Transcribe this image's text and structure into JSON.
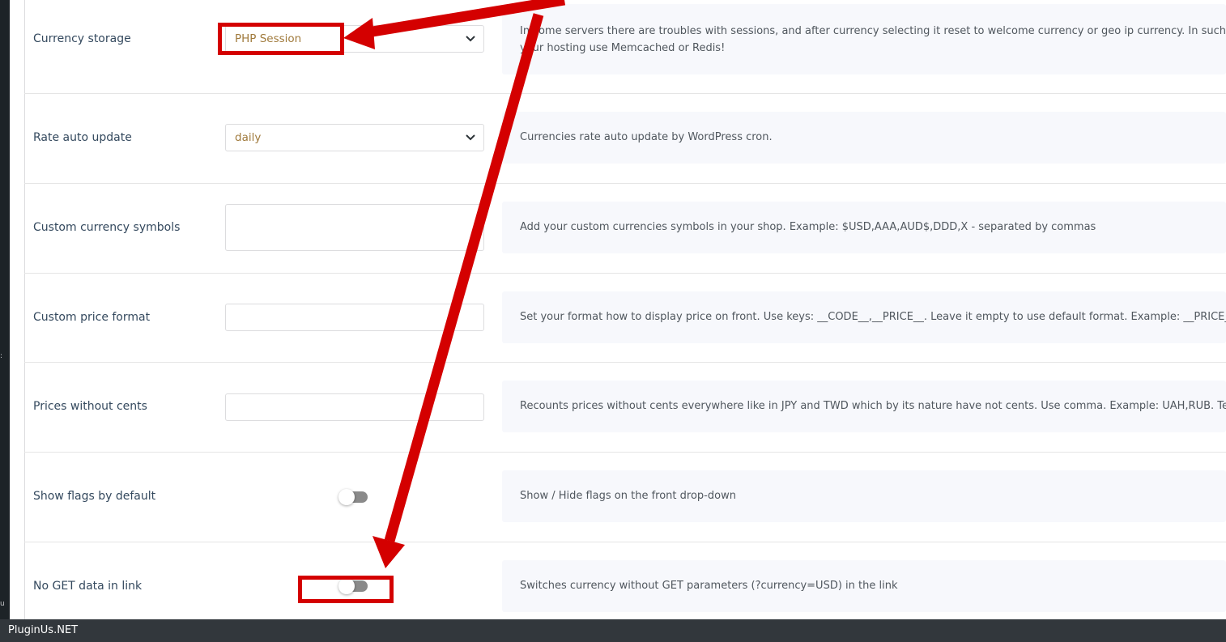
{
  "settings": {
    "rows": [
      {
        "label": "Currency storage",
        "control": "select",
        "value": "PHP Session",
        "description_lines": [
          "In some servers there are troubles with sessions, and after currency selecting it reset to welcome currency or geo ip currency. In such cases use tr",
          "your hosting use Memcached or Redis!"
        ]
      },
      {
        "label": "Rate auto update",
        "control": "select",
        "value": "daily",
        "description_lines": [
          "Currencies rate auto update by WordPress cron."
        ]
      },
      {
        "label": "Custom currency symbols",
        "control": "textarea",
        "value": "",
        "description_lines": [
          "Add your custom currencies symbols in your shop. Example: $USD,AAA,AUD$,DDD,X - separated by commas"
        ]
      },
      {
        "label": "Custom price format",
        "control": "input",
        "value": "",
        "description_lines": [
          "Set your format how to display price on front. Use keys: __CODE__,__PRICE__. Leave it empty to use default format. Example: __PRICE__ (__COD"
        ]
      },
      {
        "label": "Prices without cents",
        "control": "input",
        "value": "",
        "description_lines": [
          "Recounts prices without cents everywhere like in JPY and TWD which by its nature have not cents. Use comma. Example: UAH,RUB. Test it for ch"
        ]
      },
      {
        "label": "Show flags by default",
        "control": "toggle",
        "value": "off",
        "description_lines": [
          "Show / Hide flags on the front drop-down"
        ]
      },
      {
        "label": "No GET data in link",
        "control": "toggle",
        "value": "off",
        "description_lines": [
          "Switches currency without GET parameters (?currency=USD) in the link"
        ]
      }
    ]
  },
  "footer": {
    "brand": "PluginUs.NET"
  },
  "sidebar_marks": [
    ":",
    "u"
  ],
  "colors": {
    "annotation": "#d40000",
    "select_value": "#a07a3c",
    "label": "#34495e",
    "description_bg": "#f7f8fc"
  }
}
